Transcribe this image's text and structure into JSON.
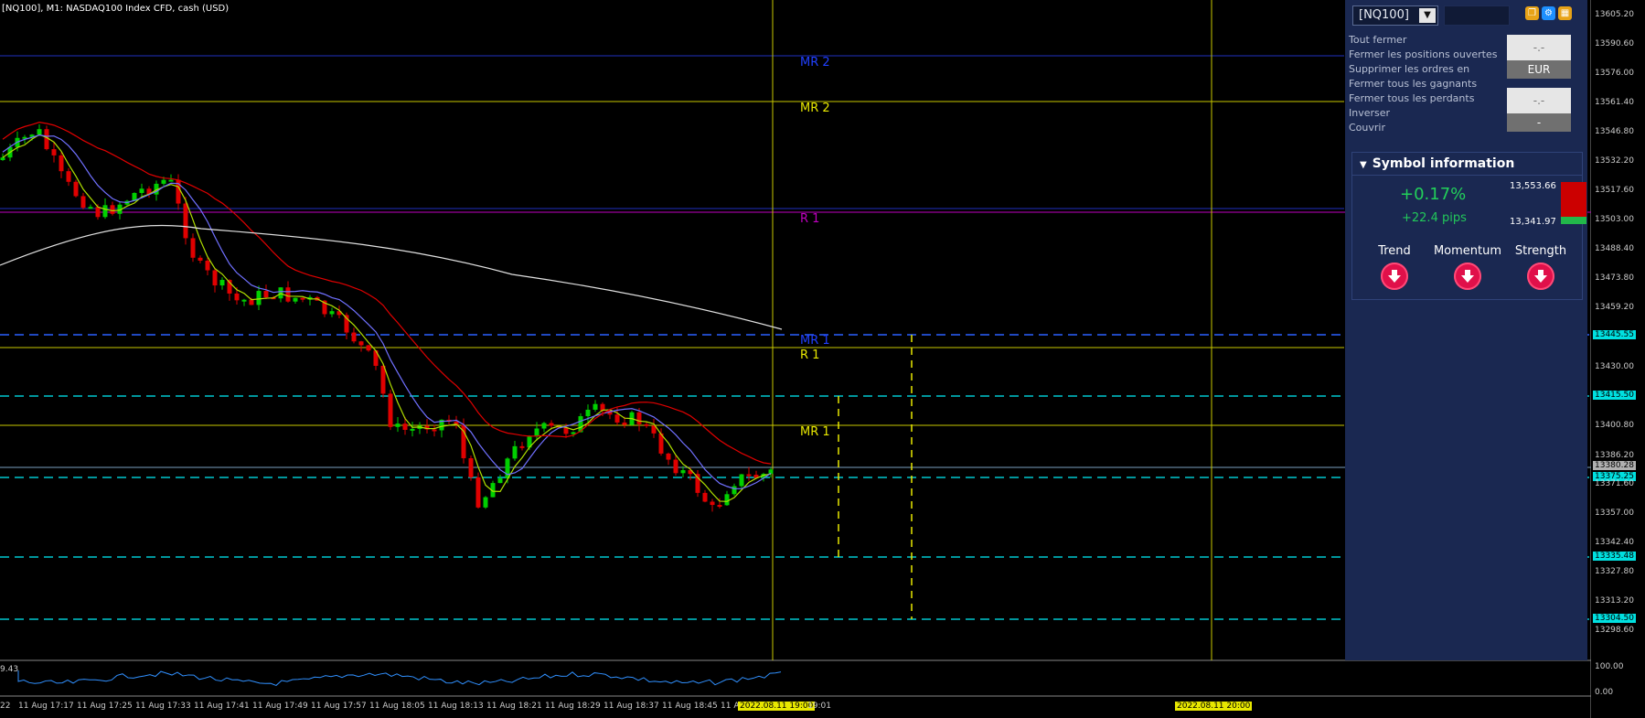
{
  "chart_title": "[NQ100], M1:  NASDAQ100 Index CFD, cash (USD)",
  "oscillator_value": "9.43",
  "oscillator_scale": [
    "100.00",
    "0.00"
  ],
  "line_labels": [
    {
      "text": "MR 2",
      "color": "#2040ff"
    },
    {
      "text": "MR 2",
      "color": "#e8e800"
    },
    {
      "text": "R 1",
      "color": "#c000c0"
    },
    {
      "text": "MR 1",
      "color": "#2040ff"
    },
    {
      "text": "R 1",
      "color": "#e8e800"
    },
    {
      "text": "MR 1",
      "color": "#e8e800"
    }
  ],
  "price_axis": [
    "13605.20",
    "13590.60",
    "13576.00",
    "13561.40",
    "13546.80",
    "13532.20",
    "13517.60",
    "13503.00",
    "13488.40",
    "13473.80",
    "13459.20",
    "13445.55",
    "13430.00",
    "13415.50",
    "13400.80",
    "13386.20",
    "13380.28",
    "13375.25",
    "13371.60",
    "13357.00",
    "13342.40",
    "13335.48",
    "13327.80",
    "13313.20",
    "13304.50",
    "13298.60"
  ],
  "time_axis": [
    "22",
    "11 Aug 17:17",
    "11 Aug 17:25",
    "11 Aug 17:33",
    "11 Aug 17:41",
    "11 Aug 17:49",
    "11 Aug 17:57",
    "11 Aug 18:05",
    "11 Aug 18:13",
    "11 Aug 18:21",
    "11 Aug 18:29",
    "11 Aug 18:37",
    "11 Aug 18:45",
    "11 A",
    "2022.08.11 19:00",
    "19:01",
    "2022.08.11 20:00"
  ],
  "panel": {
    "symbol": "[NQ100]",
    "menu": [
      "Tout fermer",
      "Fermer les positions ouvertes",
      "Supprimer les ordres en",
      "Fermer tous les gagnants",
      "Fermer tous les perdants",
      "Inverser",
      "Couvrir"
    ],
    "button1_top": "-.-",
    "button1_bottom": "EUR",
    "button2_top": "-.-",
    "button2_bottom": "-",
    "symbol_info": {
      "title": "Symbol information",
      "change_pct": "+0.17%",
      "change_pips": "+22.4 pips",
      "high": "13,553.66",
      "low": "13,341.97",
      "indicators": [
        "Trend",
        "Momentum",
        "Strength"
      ]
    }
  },
  "colors": {
    "background": "#000000",
    "bull": "#00d000",
    "bear": "#e00000",
    "fib": "#e8e800",
    "cyan": "#00c8d0",
    "panel": "#1a2851"
  }
}
